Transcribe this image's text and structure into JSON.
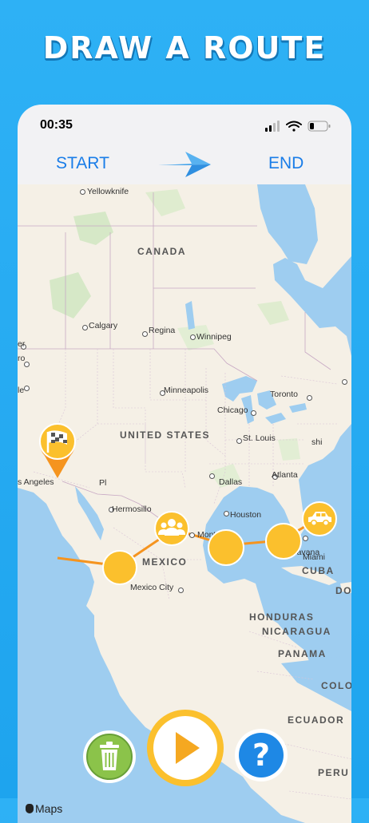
{
  "headline": "DRAW A ROUTE",
  "status": {
    "time": "00:35"
  },
  "nav": {
    "start_label": "START",
    "end_label": "END"
  },
  "map_labels": {
    "yellowknife": "Yellowknife",
    "canada": "CANADA",
    "calgary": "Calgary",
    "regina": "Regina",
    "winnipeg": "Winnipeg",
    "minneapolis": "Minneapolis",
    "toronto": "Toronto",
    "chicago": "Chicago",
    "united_states": "UNITED STATES",
    "st_louis": "St. Louis",
    "los_angeles": "s Angeles",
    "dallas": "Dallas",
    "atlanta": "Atlanta",
    "houston": "Houston",
    "hermosillo": "Hermosillo",
    "monterrey": "Monterrey",
    "miami": "Miami",
    "havana": "Havana",
    "cuba": "CUBA",
    "mexico": "MEXICO",
    "mexico_city": "Mexico City",
    "honduras": "HONDURAS",
    "nicaragua": "NICARAGUA",
    "panama": "PANAMA",
    "ecuador": "ECUADOR",
    "peru": "PERU",
    "colombia": "COLO",
    "do_re": "DO RE",
    "pl": "Pl",
    "ushi": "shi",
    "le": "le",
    "ro": "ro",
    "er": "er"
  },
  "maps_brand": "Maps",
  "colors": {
    "route": "#f5941f",
    "marker": "#fbc02d",
    "accent": "#1a7de8",
    "trash": "#8bc34a",
    "help": "#1e88e5"
  }
}
